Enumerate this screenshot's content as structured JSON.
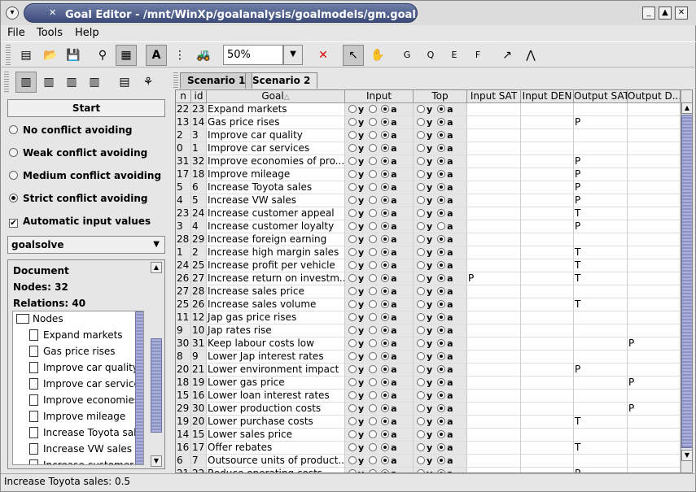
{
  "window": {
    "title": "Goal Editor - /mnt/WinXp/goalanalysis/goalmodels/gm.goal"
  },
  "menu": [
    "File",
    "Tools",
    "Help"
  ],
  "toolbar": {
    "zoom": "50%",
    "text_tool": "A",
    "formal_labels": [
      "G",
      "Q",
      "E",
      "F"
    ]
  },
  "left_panel": {
    "start_label": "Start",
    "options": [
      {
        "label": "No conflict avoiding",
        "selected": false
      },
      {
        "label": "Weak conflict avoiding",
        "selected": false
      },
      {
        "label": "Medium conflict avoiding",
        "selected": false
      },
      {
        "label": "Strict conflict avoiding",
        "selected": true
      }
    ],
    "auto_input": {
      "label": "Automatic input values",
      "checked": true
    },
    "solver": "goalsolve",
    "doc": {
      "title": "Document",
      "nodes": "Nodes: 32",
      "relations": "Relations: 40"
    },
    "tree": {
      "root": "Nodes",
      "items": [
        "Expand markets",
        "Gas price rises",
        "Improve car quality",
        "Improve car services",
        "Improve economies of production",
        "Improve mileage",
        "Increase Toyota sales",
        "Increase VW sales",
        "Increase customer appeal"
      ]
    }
  },
  "tabs": [
    {
      "label": "Scenario 1",
      "active": true
    },
    {
      "label": "Scenario 2",
      "active": false
    }
  ],
  "table": {
    "headers": [
      "n",
      "id",
      "Goal",
      "Input",
      "Top",
      "Input SAT",
      "Input DEN",
      "Output SAT",
      "Output D..."
    ],
    "sort_marker": "△",
    "radio_labels": [
      "y",
      "a"
    ],
    "rows": [
      {
        "n": "22",
        "id": "23",
        "goal": "Expand markets",
        "top": "a",
        "isat": "",
        "iden": "",
        "osat": "",
        "oden": ""
      },
      {
        "n": "13",
        "id": "14",
        "goal": "Gas price rises",
        "top": "a",
        "isat": "",
        "iden": "",
        "osat": "P",
        "oden": ""
      },
      {
        "n": "2",
        "id": "3",
        "goal": "Improve car quality",
        "top": "a",
        "isat": "",
        "iden": "",
        "osat": "",
        "oden": ""
      },
      {
        "n": "0",
        "id": "1",
        "goal": "Improve car services",
        "top": "a",
        "isat": "",
        "iden": "",
        "osat": "",
        "oden": ""
      },
      {
        "n": "31",
        "id": "32",
        "goal": "Improve economies of pro...",
        "top": "a",
        "isat": "",
        "iden": "",
        "osat": "P",
        "oden": ""
      },
      {
        "n": "17",
        "id": "18",
        "goal": "Improve mileage",
        "top": "a",
        "isat": "",
        "iden": "",
        "osat": "P",
        "oden": ""
      },
      {
        "n": "5",
        "id": "6",
        "goal": "Increase Toyota sales",
        "top": "a",
        "isat": "",
        "iden": "",
        "osat": "P",
        "oden": ""
      },
      {
        "n": "4",
        "id": "5",
        "goal": "Increase VW sales",
        "top": "a",
        "isat": "",
        "iden": "",
        "osat": "P",
        "oden": ""
      },
      {
        "n": "23",
        "id": "24",
        "goal": "Increase customer appeal",
        "top": "a",
        "isat": "",
        "iden": "",
        "osat": "T",
        "oden": ""
      },
      {
        "n": "3",
        "id": "4",
        "goal": "Increase customer loyalty",
        "top": "none",
        "isat": "",
        "iden": "",
        "osat": "P",
        "oden": ""
      },
      {
        "n": "28",
        "id": "29",
        "goal": "Increase foreign earning",
        "top": "a",
        "isat": "",
        "iden": "",
        "osat": "",
        "oden": ""
      },
      {
        "n": "1",
        "id": "2",
        "goal": "Increase high margin sales",
        "top": "a",
        "isat": "",
        "iden": "",
        "osat": "T",
        "oden": ""
      },
      {
        "n": "24",
        "id": "25",
        "goal": "Increase profit per vehicle",
        "top": "a",
        "isat": "",
        "iden": "",
        "osat": "T",
        "oden": ""
      },
      {
        "n": "26",
        "id": "27",
        "goal": "Increase return on investm...",
        "top": "a",
        "isat": "P",
        "iden": "",
        "osat": "T",
        "oden": ""
      },
      {
        "n": "27",
        "id": "28",
        "goal": "Increase sales price",
        "top": "a",
        "isat": "",
        "iden": "",
        "osat": "",
        "oden": ""
      },
      {
        "n": "25",
        "id": "26",
        "goal": "Increase sales volume",
        "top": "a",
        "isat": "",
        "iden": "",
        "osat": "T",
        "oden": ""
      },
      {
        "n": "11",
        "id": "12",
        "goal": "Jap gas price rises",
        "top": "a",
        "isat": "",
        "iden": "",
        "osat": "",
        "oden": ""
      },
      {
        "n": "9",
        "id": "10",
        "goal": "Jap rates rise",
        "top": "a",
        "isat": "",
        "iden": "",
        "osat": "",
        "oden": ""
      },
      {
        "n": "30",
        "id": "31",
        "goal": "Keep labour costs low",
        "top": "a",
        "isat": "",
        "iden": "",
        "osat": "",
        "oden": "P"
      },
      {
        "n": "8",
        "id": "9",
        "goal": "Lower Jap interest rates",
        "top": "a",
        "isat": "",
        "iden": "",
        "osat": "",
        "oden": ""
      },
      {
        "n": "20",
        "id": "21",
        "goal": "Lower environment impact",
        "top": "a",
        "isat": "",
        "iden": "",
        "osat": "P",
        "oden": ""
      },
      {
        "n": "18",
        "id": "19",
        "goal": "Lower gas price",
        "top": "a",
        "isat": "",
        "iden": "",
        "osat": "",
        "oden": "P"
      },
      {
        "n": "15",
        "id": "16",
        "goal": "Lower loan interest rates",
        "top": "a",
        "isat": "",
        "iden": "",
        "osat": "",
        "oden": ""
      },
      {
        "n": "29",
        "id": "30",
        "goal": "Lower production costs",
        "top": "a",
        "isat": "",
        "iden": "",
        "osat": "",
        "oden": "P"
      },
      {
        "n": "19",
        "id": "20",
        "goal": "Lower purchase costs",
        "top": "a",
        "isat": "",
        "iden": "",
        "osat": "T",
        "oden": ""
      },
      {
        "n": "14",
        "id": "15",
        "goal": "Lower sales price",
        "top": "a",
        "isat": "",
        "iden": "",
        "osat": "",
        "oden": ""
      },
      {
        "n": "16",
        "id": "17",
        "goal": "Offer rebates",
        "top": "a",
        "isat": "",
        "iden": "",
        "osat": "T",
        "oden": ""
      },
      {
        "n": "6",
        "id": "7",
        "goal": "Outsource units of product...",
        "top": "a",
        "isat": "",
        "iden": "",
        "osat": "",
        "oden": ""
      },
      {
        "n": "21",
        "id": "22",
        "goal": "Reduce operating costs",
        "top": "a",
        "isat": "",
        "iden": "",
        "osat": "P",
        "oden": ""
      }
    ]
  },
  "status": "Increase Toyota sales: 0.5",
  "colors": {
    "title_bar": "#3b4a78",
    "scroll_thumb": "#8c92c4",
    "background": "#e6e6e6"
  }
}
